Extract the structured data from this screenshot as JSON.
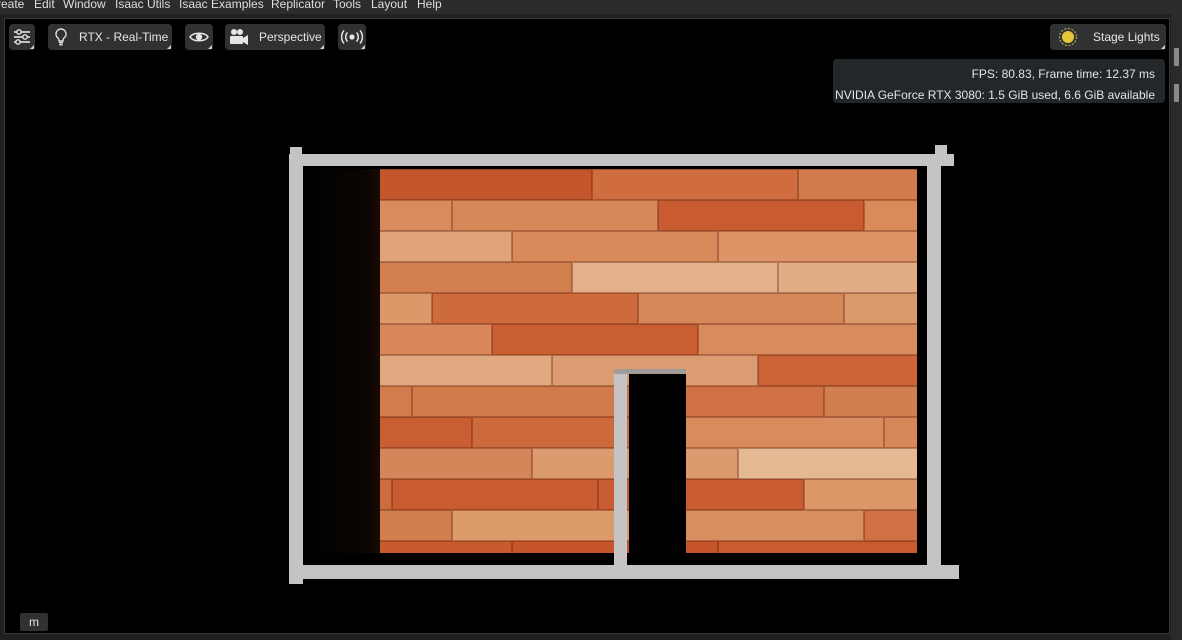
{
  "menu": {
    "items": [
      "reate",
      "Edit",
      "Window",
      "Isaac Utils",
      "Isaac Examples",
      "Replicator",
      "Tools",
      "Layout",
      "Help"
    ]
  },
  "toolbar": {
    "settings_icon": "sliders-icon",
    "render_mode": {
      "icon": "lightbulb-icon",
      "label": "RTX - Real-Time"
    },
    "visibility_icon": "eye-icon",
    "camera": {
      "icon": "movie-camera-icon",
      "label": "Perspective"
    },
    "broadcast_icon": "broadcast-icon",
    "lights": {
      "icon": "sun-icon",
      "label": "Stage Lights"
    }
  },
  "stats": {
    "fps_line": "FPS: 80.83, Frame time: 12.37 ms",
    "gpu_line": "NVIDIA GeForce RTX 3080: 1.5 GiB used, 6.6 GiB available"
  },
  "footer": {
    "m_button": "m"
  },
  "colors": {
    "viewport_bg": "#000000",
    "wall": "#c5c3c3",
    "floor_base": "#c8734a",
    "panel": "#2f3133"
  }
}
